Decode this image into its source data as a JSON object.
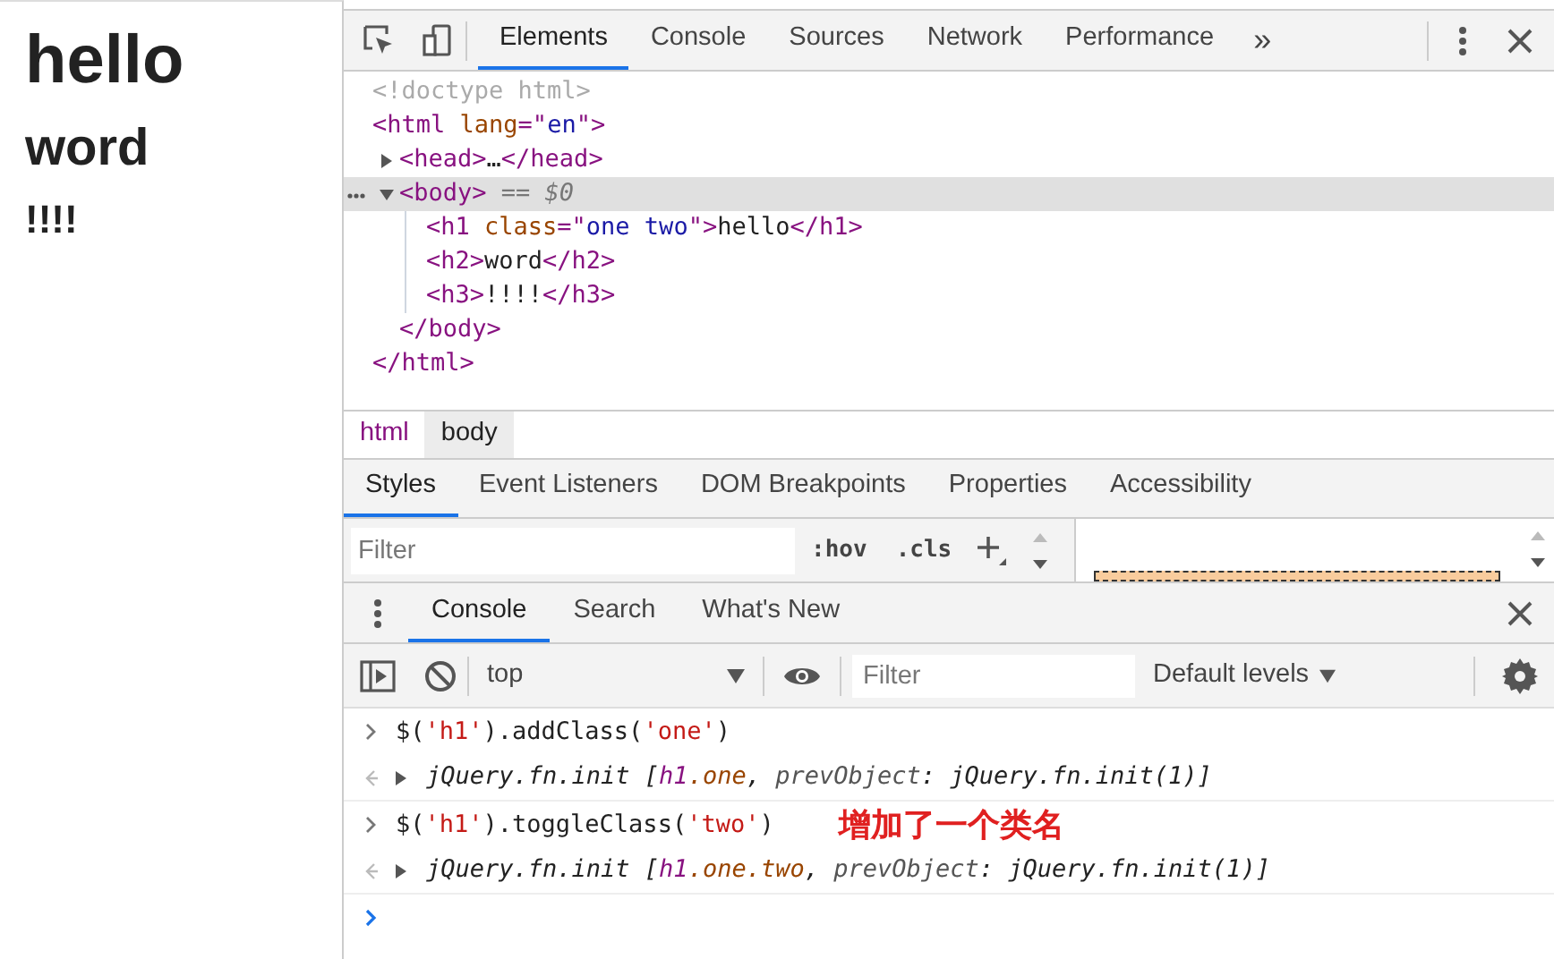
{
  "page": {
    "headings": [
      {
        "kind": "h1",
        "text": "hello"
      },
      {
        "kind": "h2",
        "text": "word"
      },
      {
        "kind": "h3",
        "text": "!!!!"
      }
    ]
  },
  "devtools": {
    "tabs": [
      {
        "label": "Elements",
        "selected": true
      },
      {
        "label": "Console",
        "selected": false
      },
      {
        "label": "Sources",
        "selected": false
      },
      {
        "label": "Network",
        "selected": false
      },
      {
        "label": "Performance",
        "selected": false
      }
    ],
    "more": "»",
    "tree": [
      {
        "open": [
          {
            "kind": "comment",
            "text": "<!doctype html>"
          }
        ],
        "selected": false
      },
      {
        "open": [
          {
            "kind": "tag",
            "text": "<html "
          },
          {
            "kind": "attr",
            "text": "lang"
          },
          {
            "kind": "tag",
            "text": "=\""
          },
          {
            "kind": "value",
            "text": "en"
          },
          {
            "kind": "tag",
            "text": "\">"
          }
        ],
        "selected": false,
        "close": [
          {
            "kind": "tag",
            "text": "</html>"
          }
        ],
        "children": [
          {
            "open": [
              {
                "kind": "tag",
                "text": "<head>"
              },
              {
                "kind": "text",
                "text": "…"
              },
              {
                "kind": "tag",
                "text": "</head>"
              }
            ],
            "expanded": false,
            "selected": false
          },
          {
            "open": [
              {
                "kind": "tag",
                "text": "<body>"
              },
              {
                "kind": "marker",
                "text": " == $0"
              }
            ],
            "expanded": true,
            "selected": true,
            "close": [
              {
                "kind": "tag",
                "text": "</body>"
              }
            ],
            "children": [
              {
                "open": [
                  {
                    "kind": "tag",
                    "text": "<h1 "
                  },
                  {
                    "kind": "attr",
                    "text": "class"
                  },
                  {
                    "kind": "tag",
                    "text": "=\""
                  },
                  {
                    "kind": "value",
                    "text": "one two"
                  },
                  {
                    "kind": "tag",
                    "text": "\">"
                  },
                  {
                    "kind": "text",
                    "text": "hello"
                  },
                  {
                    "kind": "tag",
                    "text": "</h1>"
                  }
                ],
                "selected": false
              },
              {
                "open": [
                  {
                    "kind": "tag",
                    "text": "<h2>"
                  },
                  {
                    "kind": "text",
                    "text": "word"
                  },
                  {
                    "kind": "tag",
                    "text": "</h2>"
                  }
                ],
                "selected": false
              },
              {
                "open": [
                  {
                    "kind": "tag",
                    "text": "<h3>"
                  },
                  {
                    "kind": "text",
                    "text": "!!!!"
                  },
                  {
                    "kind": "tag",
                    "text": "</h3>"
                  }
                ],
                "selected": false
              }
            ]
          }
        ]
      }
    ],
    "breadcrumbs": [
      {
        "label": "html",
        "selected": false
      },
      {
        "label": "body",
        "selected": true
      }
    ],
    "sidebar_tabs": [
      {
        "label": "Styles",
        "selected": true
      },
      {
        "label": "Event Listeners",
        "selected": false
      },
      {
        "label": "DOM Breakpoints",
        "selected": false
      },
      {
        "label": "Properties",
        "selected": false
      },
      {
        "label": "Accessibility",
        "selected": false
      }
    ],
    "styles_filter": {
      "placeholder": "Filter"
    },
    "styles_buttons": [
      ":hov",
      ".cls"
    ],
    "drawer_tabs": [
      {
        "label": "Console",
        "selected": true
      },
      {
        "label": "Search",
        "selected": false
      },
      {
        "label": "What's New",
        "selected": false
      }
    ],
    "console_toolbar": {
      "context": "top",
      "filter": {
        "placeholder": "Filter"
      },
      "levels": "Default levels"
    },
    "console": [
      {
        "kind": "input",
        "tokens": [
          {
            "kind": "plain",
            "text": "$("
          },
          {
            "kind": "string",
            "text": "'h1'"
          },
          {
            "kind": "plain",
            "text": ").addClass("
          },
          {
            "kind": "string",
            "text": "'one'"
          },
          {
            "kind": "plain",
            "text": ")"
          }
        ]
      },
      {
        "kind": "output",
        "tokens": [
          {
            "kind": "italic",
            "text": "jQuery.fn.init ["
          },
          {
            "kind": "tagname",
            "text": "h1"
          },
          {
            "kind": "classname",
            "text": ".one"
          },
          {
            "kind": "italic",
            "text": ", "
          },
          {
            "kind": "key",
            "text": "prevObject"
          },
          {
            "kind": "italic",
            "text": ": jQuery.fn.init(1)]"
          }
        ]
      },
      {
        "kind": "input",
        "tokens": [
          {
            "kind": "plain",
            "text": "$("
          },
          {
            "kind": "string",
            "text": "'h1'"
          },
          {
            "kind": "plain",
            "text": ").toggleClass("
          },
          {
            "kind": "string",
            "text": "'two'"
          },
          {
            "kind": "plain",
            "text": ")"
          }
        ],
        "note": "增加了一个类名"
      },
      {
        "kind": "output",
        "tokens": [
          {
            "kind": "italic",
            "text": "jQuery.fn.init ["
          },
          {
            "kind": "tagname",
            "text": "h1"
          },
          {
            "kind": "classname",
            "text": ".one.two"
          },
          {
            "kind": "italic",
            "text": ", "
          },
          {
            "kind": "key",
            "text": "prevObject"
          },
          {
            "kind": "italic",
            "text": ": jQuery.fn.init(1)]"
          }
        ]
      }
    ]
  }
}
